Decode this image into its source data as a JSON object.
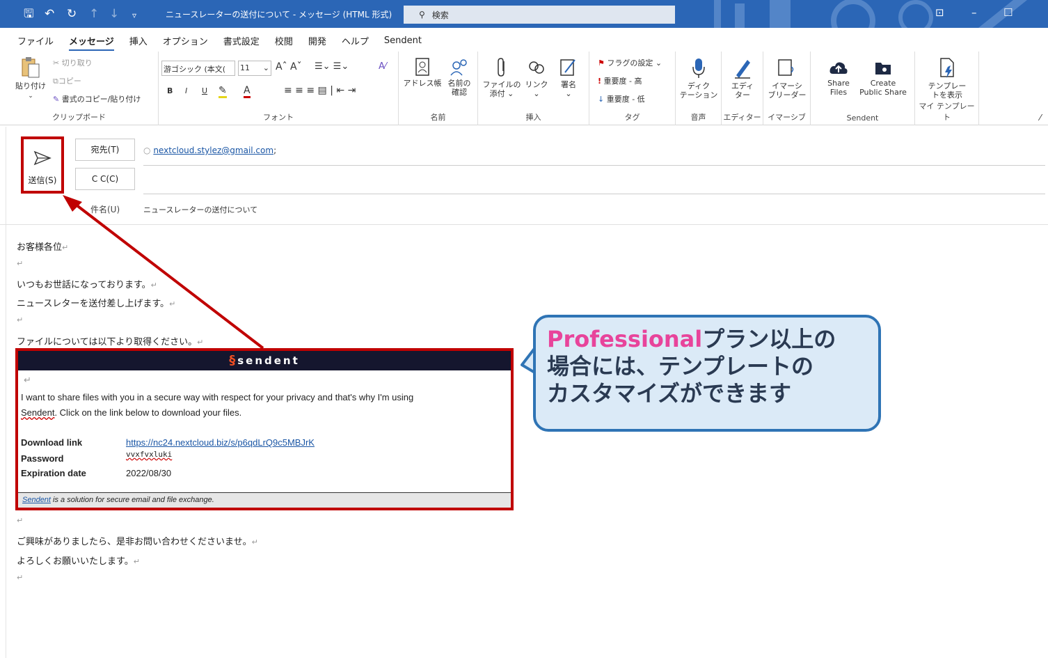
{
  "titlebar": {
    "title": "ニュースレーターの送付について - メッセージ (HTML 形式)",
    "search_placeholder": "検索"
  },
  "menu": {
    "tabs": [
      "ファイル",
      "メッセージ",
      "挿入",
      "オプション",
      "書式設定",
      "校閲",
      "開発",
      "ヘルプ",
      "Sendent"
    ],
    "active": "メッセージ"
  },
  "ribbon": {
    "clipboard": {
      "paste": "貼り付け",
      "cut": "切り取り",
      "copy": "コピー",
      "format_painter": "書式のコピー/貼り付け",
      "label": "クリップボード"
    },
    "font": {
      "font_name": "游ゴシック (本文(",
      "font_size": "11",
      "bold": "B",
      "italic": "I",
      "underline": "U",
      "highlight": "A",
      "label": "フォント"
    },
    "names": {
      "address_book": "アドレス帳",
      "check_names_1": "名前の",
      "check_names_2": "確認",
      "label": "名前"
    },
    "insert": {
      "attach_1": "ファイルの",
      "attach_2": "添付",
      "link": "リンク",
      "signature": "署名",
      "label": "挿入"
    },
    "tags": {
      "follow_up": "フラグの設定",
      "high": "重要度 - 高",
      "low": "重要度 - 低",
      "label": "タグ"
    },
    "voice": {
      "dictate_1": "ディク",
      "dictate_2": "テーション",
      "label": "音声"
    },
    "editor": {
      "editor_1": "エディ",
      "editor_2": "ター",
      "label": "エディター"
    },
    "immersive": {
      "reader_1": "イマーシ",
      "reader_2": "ブリーダー",
      "label": "イマーシブ"
    },
    "sendent": {
      "share_1": "Share",
      "share_2": "Files",
      "public_1": "Create",
      "public_2": "Public Share",
      "label": "Sendent"
    },
    "templates": {
      "view_1": "テンプレー",
      "view_2": "トを表示",
      "label": "マイ テンプレート"
    }
  },
  "header": {
    "send_label": "送信(S)",
    "to_label": "宛先(T)",
    "cc_label": "C C(C)",
    "subject_label": "件名(U)",
    "to_value": "nextcloud.stylez@gmail.com",
    "to_suffix": ";",
    "subject_value": "ニュースレーターの送付について"
  },
  "body": {
    "line1": "お客様各位",
    "line2": "いつもお世話になっております。",
    "line3": "ニュースレターを送付差し上げます。",
    "line4": "ファイルについては以下より取得ください。",
    "line5": "ご興味がありましたら、是非お問い合わせくださいませ。",
    "line6": "よろしくお願いいたします。",
    "mark": "↵"
  },
  "template": {
    "brand": "sendent",
    "intro": "I want to share files with you in a secure way with respect for your privacy and that's why I'm using",
    "intro2_link": "Sendent",
    "intro2": ". Click on the link below to download your files.",
    "download_label": "Download link",
    "download_url": "https://nc24.nextcloud.biz/s/p6qdLrQ9c5MBJrK",
    "password_label": "Password",
    "password_value": "vvxfvxluki",
    "expiration_label": "Expiration date",
    "expiration_value": "2022/08/30",
    "footer_link": "Sendent",
    "footer_text": " is a solution for secure email and file exchange."
  },
  "callout": {
    "highlight": "Professional",
    "line1_rest": "プラン以上の",
    "line2": "場合には、テンプレートの",
    "line3": "カスタマイズができます"
  },
  "colors": {
    "titlebar": "#2b66b6",
    "annotation_red": "#c00000",
    "callout_fill": "#dbeaf7",
    "callout_border": "#2f74b5",
    "callout_highlight": "#e8449b",
    "template_header": "#15162e"
  }
}
